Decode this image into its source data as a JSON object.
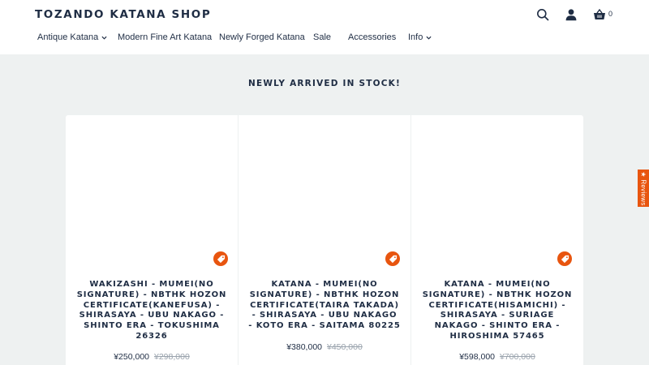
{
  "header": {
    "logo": "TOZANDO KATANA SHOP",
    "icons": [
      "search-icon",
      "account-icon",
      "cart-basket-icon"
    ],
    "cart_count": "0"
  },
  "nav": {
    "items": [
      {
        "label": "Antique Katana",
        "dropdown": true
      },
      {
        "label": "Modern Fine Art Katana",
        "dropdown": false
      },
      {
        "label": "Newly Forged Katana",
        "dropdown": false
      },
      {
        "label": "Sale",
        "dropdown": false
      },
      {
        "label": "Accessories",
        "dropdown": false
      },
      {
        "label": "Info",
        "dropdown": true
      }
    ]
  },
  "section": {
    "title": "NEWLY ARRIVED IN STOCK!"
  },
  "products": [
    {
      "title": "WAKIZASHI - MUMEI(NO SIGNATURE) - NBTHK HOZON CERTIFICATE(KANEFUSA) - SHIRASAYA - UBU NAKAGO - SHINTO ERA - TOKUSHIMA 26326",
      "price": "¥250,000",
      "compare_price": "¥298,000"
    },
    {
      "title": "KATANA - MUMEI(NO SIGNATURE) - NBTHK HOZON CERTIFICATE(TAIRA TAKADA) - SHIRASAYA - UBU NAKAGO - KOTO ERA - SAITAMA 80225",
      "price": "¥380,000",
      "compare_price": "¥450,000"
    },
    {
      "title": "KATANA - MUMEI(NO SIGNATURE) - NBTHK HOZON CERTIFICATE(HISAMICHI) - SHIRASAYA - SURIAGE NAKAGO - SHINTO ERA - HIROSHIMA 57465",
      "price": "¥598,000",
      "compare_price": "¥700,000"
    }
  ],
  "reviews_tab": {
    "star": "★",
    "label": "Reviews"
  },
  "colors": {
    "brand_text": "#1f2d44",
    "accent": "#e8550f",
    "background": "#eef1f1",
    "muted": "#9aa3ad"
  }
}
